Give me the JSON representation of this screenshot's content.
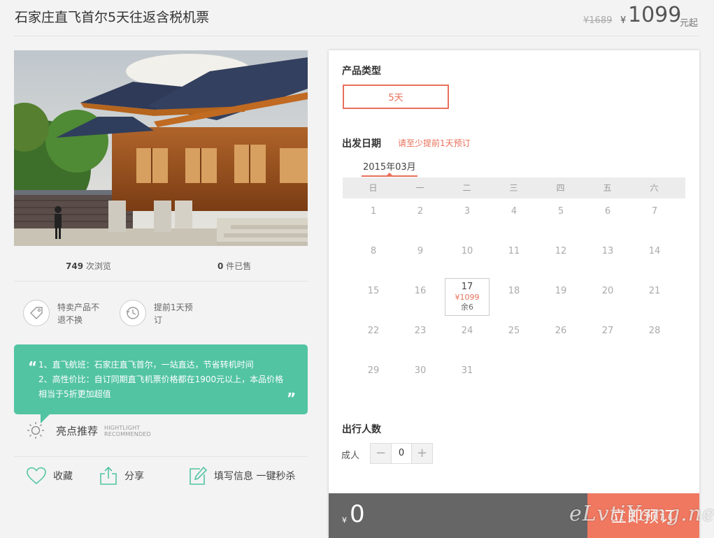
{
  "header": {
    "title": "石家庄直飞首尔5天往返含税机票",
    "original_price": "¥1689",
    "currency_symbol": "¥",
    "price": "1099",
    "price_unit": "元起"
  },
  "stats": {
    "views_count": "749",
    "views_label": "次浏览",
    "sold_count": "0",
    "sold_label": "件已售"
  },
  "features": [
    {
      "icon": "tag-icon",
      "text": "特卖产品不退不换"
    },
    {
      "icon": "clock-history-icon",
      "text": "提前1天预订"
    }
  ],
  "highlight": {
    "lines": [
      "1、直飞航班：石家庄直飞首尔，一站直达，节省转机时间",
      "2、高性价比：自订同期直飞机票价格都在1900元以上，本品价格",
      "相当于5折更加超值"
    ],
    "title": "亮点推荐",
    "subtitle_line1": "HIGHTLIGHT",
    "subtitle_line2": "RECOMMENDED"
  },
  "actions": {
    "favorite": "收藏",
    "share": "分享",
    "fill_info": "填写信息 一键秒杀"
  },
  "booking": {
    "product_type_title": "产品类型",
    "product_type_option": "5天",
    "departure_title": "出发日期",
    "departure_hint": "请至少提前1天预订",
    "month": "2015年03月",
    "weekdays": [
      "日",
      "一",
      "二",
      "三",
      "四",
      "五",
      "六"
    ],
    "days": [
      1,
      2,
      3,
      4,
      5,
      6,
      7,
      8,
      9,
      10,
      11,
      12,
      13,
      14,
      15,
      16,
      17,
      18,
      19,
      20,
      21,
      22,
      23,
      24,
      25,
      26,
      27,
      28,
      29,
      30,
      31
    ],
    "available_day": {
      "day": "17",
      "price": "¥1099",
      "remaining": "余6"
    },
    "travelers_title": "出行人数",
    "adult_label": "成人",
    "adult_count": "0",
    "minus": "−",
    "plus": "+",
    "total_symbol": "¥",
    "total": "0",
    "book_label": "立即预订"
  },
  "watermark": "eLvtiYang.net",
  "colors": {
    "accent": "#e8705a",
    "teal": "#52c4a2",
    "book_button": "#f07860",
    "bottom_bar": "#666666"
  }
}
